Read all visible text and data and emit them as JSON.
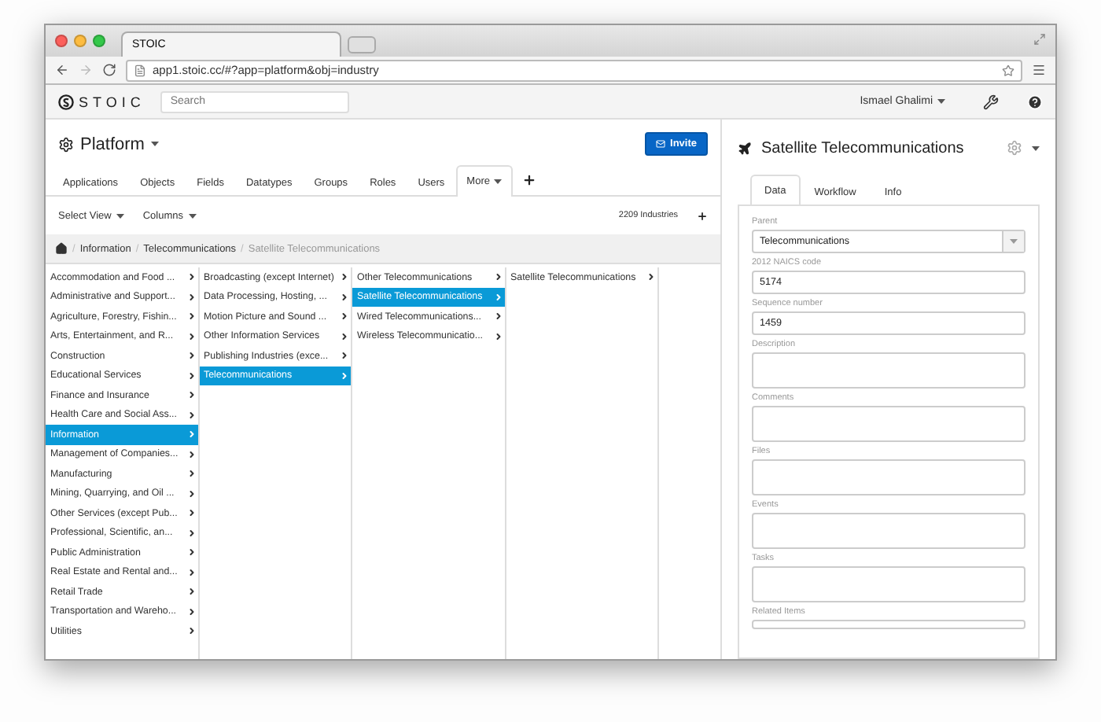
{
  "browser": {
    "tab_title": "STOIC",
    "url": "app1.stoic.cc/#?app=platform&obj=industry"
  },
  "header": {
    "logo": "STOIC",
    "search_placeholder": "Search",
    "user": "Ismael Ghalimi"
  },
  "workspace": {
    "title": "Platform",
    "invite": "Invite",
    "tabs": [
      {
        "label": "Applications",
        "selected": false
      },
      {
        "label": "Objects",
        "selected": false
      },
      {
        "label": "Fields",
        "selected": false
      },
      {
        "label": "Datatypes",
        "selected": false
      },
      {
        "label": "Groups",
        "selected": false
      },
      {
        "label": "Roles",
        "selected": false
      },
      {
        "label": "Users",
        "selected": false
      },
      {
        "label": "More",
        "selected": true
      }
    ],
    "select_view": "Select View",
    "columns_menu": "Columns",
    "count": "2209 Industries",
    "breadcrumb_separator": "/",
    "breadcrumb": [
      "Information",
      "Telecommunications",
      "Satellite Telecommunications"
    ],
    "columns": [
      [
        {
          "label": "Accommodation and Food ...",
          "selected": false
        },
        {
          "label": "Administrative and Support...",
          "selected": false
        },
        {
          "label": "Agriculture, Forestry, Fishin...",
          "selected": false
        },
        {
          "label": "Arts, Entertainment, and R...",
          "selected": false
        },
        {
          "label": "Construction",
          "selected": false
        },
        {
          "label": "Educational Services",
          "selected": false
        },
        {
          "label": "Finance and Insurance",
          "selected": false
        },
        {
          "label": "Health Care and Social Ass...",
          "selected": false
        },
        {
          "label": "Information",
          "selected": true
        },
        {
          "label": "Management of Companies...",
          "selected": false
        },
        {
          "label": "Manufacturing",
          "selected": false
        },
        {
          "label": "Mining, Quarrying, and Oil ...",
          "selected": false
        },
        {
          "label": "Other Services (except Pub...",
          "selected": false
        },
        {
          "label": "Professional, Scientific, an...",
          "selected": false
        },
        {
          "label": "Public Administration",
          "selected": false
        },
        {
          "label": "Real Estate and Rental and...",
          "selected": false
        },
        {
          "label": "Retail Trade",
          "selected": false
        },
        {
          "label": "Transportation and Wareho...",
          "selected": false
        },
        {
          "label": "Utilities",
          "selected": false
        }
      ],
      [
        {
          "label": "Broadcasting (except Internet)",
          "selected": false
        },
        {
          "label": "Data Processing, Hosting, ...",
          "selected": false
        },
        {
          "label": "Motion Picture and Sound ...",
          "selected": false
        },
        {
          "label": "Other Information Services",
          "selected": false
        },
        {
          "label": "Publishing Industries (exce...",
          "selected": false
        },
        {
          "label": "Telecommunications",
          "selected": true
        }
      ],
      [
        {
          "label": "Other Telecommunications",
          "selected": false
        },
        {
          "label": "Satellite Telecommunications",
          "selected": true
        },
        {
          "label": "Wired Telecommunications...",
          "selected": false
        },
        {
          "label": "Wireless Telecommunicatio...",
          "selected": false
        }
      ],
      [
        {
          "label": "Satellite Telecommunications",
          "selected": false
        }
      ]
    ]
  },
  "record": {
    "title": "Satellite Telecommunications",
    "tabs": [
      {
        "label": "Data",
        "selected": true
      },
      {
        "label": "Workflow",
        "selected": false
      },
      {
        "label": "Info",
        "selected": false
      }
    ],
    "fields": [
      {
        "label": "Parent",
        "kind": "select",
        "value": "Telecommunications"
      },
      {
        "label": "2012 NAICS code",
        "kind": "input",
        "value": "5174"
      },
      {
        "label": "Sequence number",
        "kind": "input",
        "value": "1459"
      },
      {
        "label": "Description",
        "kind": "textarea"
      },
      {
        "label": "Comments",
        "kind": "textarea"
      },
      {
        "label": "Files",
        "kind": "textarea"
      },
      {
        "label": "Events",
        "kind": "textarea"
      },
      {
        "label": "Tasks",
        "kind": "textarea"
      },
      {
        "label": "Related Items",
        "kind": "cut"
      }
    ]
  }
}
